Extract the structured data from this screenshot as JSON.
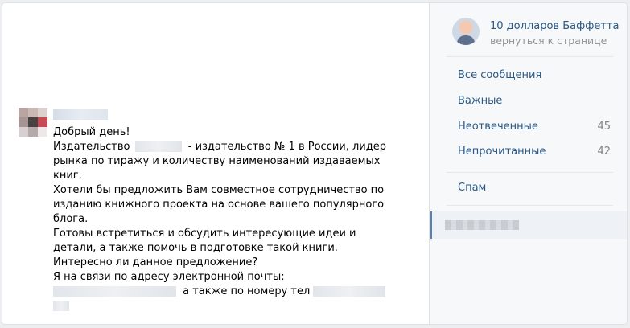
{
  "message": {
    "lines": {
      "l1": "Добрый день!",
      "l2a": "Издательство",
      "l2b": "- издательство № 1 в России, лидер",
      "l3": "рынка по тиражу и количеству наименований издаваемых",
      "l4": "книг.",
      "l5": "Хотели бы предложить Вам совместное сотрудничество по",
      "l6": "изданию книжного проекта на основе вашего популярного",
      "l7": "блога.",
      "l8": "Готовы встретиться и обсудить интересующие идеи и",
      "l9": "детали, а также помочь в подготовке такой книги.",
      "l10": "Интересно ли данное предложение?",
      "l11": "Я на связи по адресу электронной почты:",
      "l12": "а также по номеру тел"
    }
  },
  "sidebar": {
    "profile": {
      "name": "10 долларов Баффетта",
      "back": "вернуться к странице"
    },
    "items": [
      {
        "label": "Все сообщения",
        "count": ""
      },
      {
        "label": "Важные",
        "count": ""
      },
      {
        "label": "Неотвеченные",
        "count": "45"
      },
      {
        "label": "Непрочитанные",
        "count": "42"
      },
      {
        "label": "Спам",
        "count": ""
      }
    ]
  },
  "colors": {
    "link": "#2a5885",
    "muted": "#939393",
    "accent": "#5181b8"
  }
}
